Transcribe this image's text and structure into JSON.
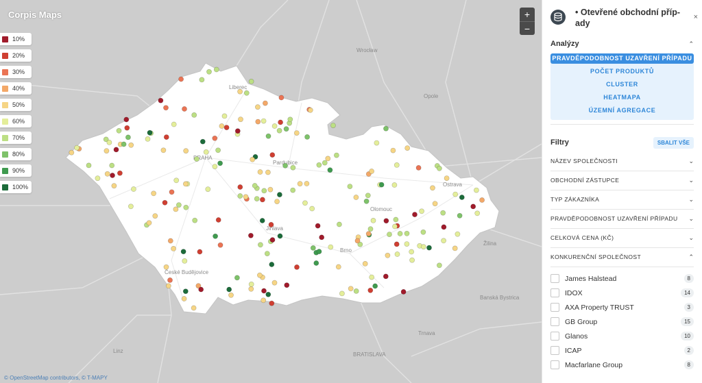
{
  "map": {
    "title": "Corpis Maps",
    "legend": [
      {
        "label": "10%",
        "color": "#a01b2b"
      },
      {
        "label": "20%",
        "color": "#cf3f32"
      },
      {
        "label": "30%",
        "color": "#ea7454"
      },
      {
        "label": "40%",
        "color": "#f3a868"
      },
      {
        "label": "50%",
        "color": "#f6d585"
      },
      {
        "label": "60%",
        "color": "#e4ee9a"
      },
      {
        "label": "70%",
        "color": "#bcdf84"
      },
      {
        "label": "80%",
        "color": "#7ec26a"
      },
      {
        "label": "90%",
        "color": "#3f9a4f"
      },
      {
        "label": "100%",
        "color": "#1c6b3a"
      }
    ],
    "zoom_in": "+",
    "zoom_out": "−",
    "attribution": "© OpenStreetMap contributors, © T-MAPY",
    "place_labels": [
      "Wrocław",
      "Opole",
      "Ostrava",
      "Olomouc",
      "Brno",
      "Jihlava",
      "Pardubice",
      "Liberec",
      "České Budějovice",
      "Žilina",
      "Banská Bystrica",
      "Trnava",
      "BRATISLAVA",
      "Linz",
      "PRAHA"
    ]
  },
  "panel": {
    "title": "• Otevřené obchodní příp­ady",
    "close": "×",
    "analyses_title": "Analýzy",
    "analyses": [
      {
        "label": "PRAVDĚPODOBNOST UZAVŘENÍ PŘÍPADU",
        "active": true
      },
      {
        "label": "POČET PRODUKTŮ",
        "active": false
      },
      {
        "label": "CLUSTER",
        "active": false
      },
      {
        "label": "HEATMAPA",
        "active": false
      },
      {
        "label": "ÚZEMNÍ AGREGACE",
        "active": false
      }
    ],
    "filters_title": "Filtry",
    "collapse_all": "SBALIT VŠE",
    "filters": [
      {
        "label": "NÁZEV SPOLEČNOSTI",
        "open": false
      },
      {
        "label": "OBCHODNÍ ZÁSTUPCE",
        "open": false
      },
      {
        "label": "TYP ZÁKAZNÍKA",
        "open": false
      },
      {
        "label": "PRAVDĚPODOBNOST UZAVŘENÍ PŘÍPADU",
        "open": false
      },
      {
        "label": "CELKOVÁ CENA (KČ)",
        "open": false
      },
      {
        "label": "KONKURENČNÍ SPOLEČNOST",
        "open": true
      }
    ],
    "competitors": [
      {
        "name": "James Halstead",
        "count": "8"
      },
      {
        "name": "IDOX",
        "count": "14"
      },
      {
        "name": "AXA Property TRUST",
        "count": "3"
      },
      {
        "name": "GB Group",
        "count": "15"
      },
      {
        "name": "Glanos",
        "count": "10"
      },
      {
        "name": "ICAP",
        "count": "2"
      },
      {
        "name": "Macfarlane Group",
        "count": "8"
      }
    ]
  }
}
